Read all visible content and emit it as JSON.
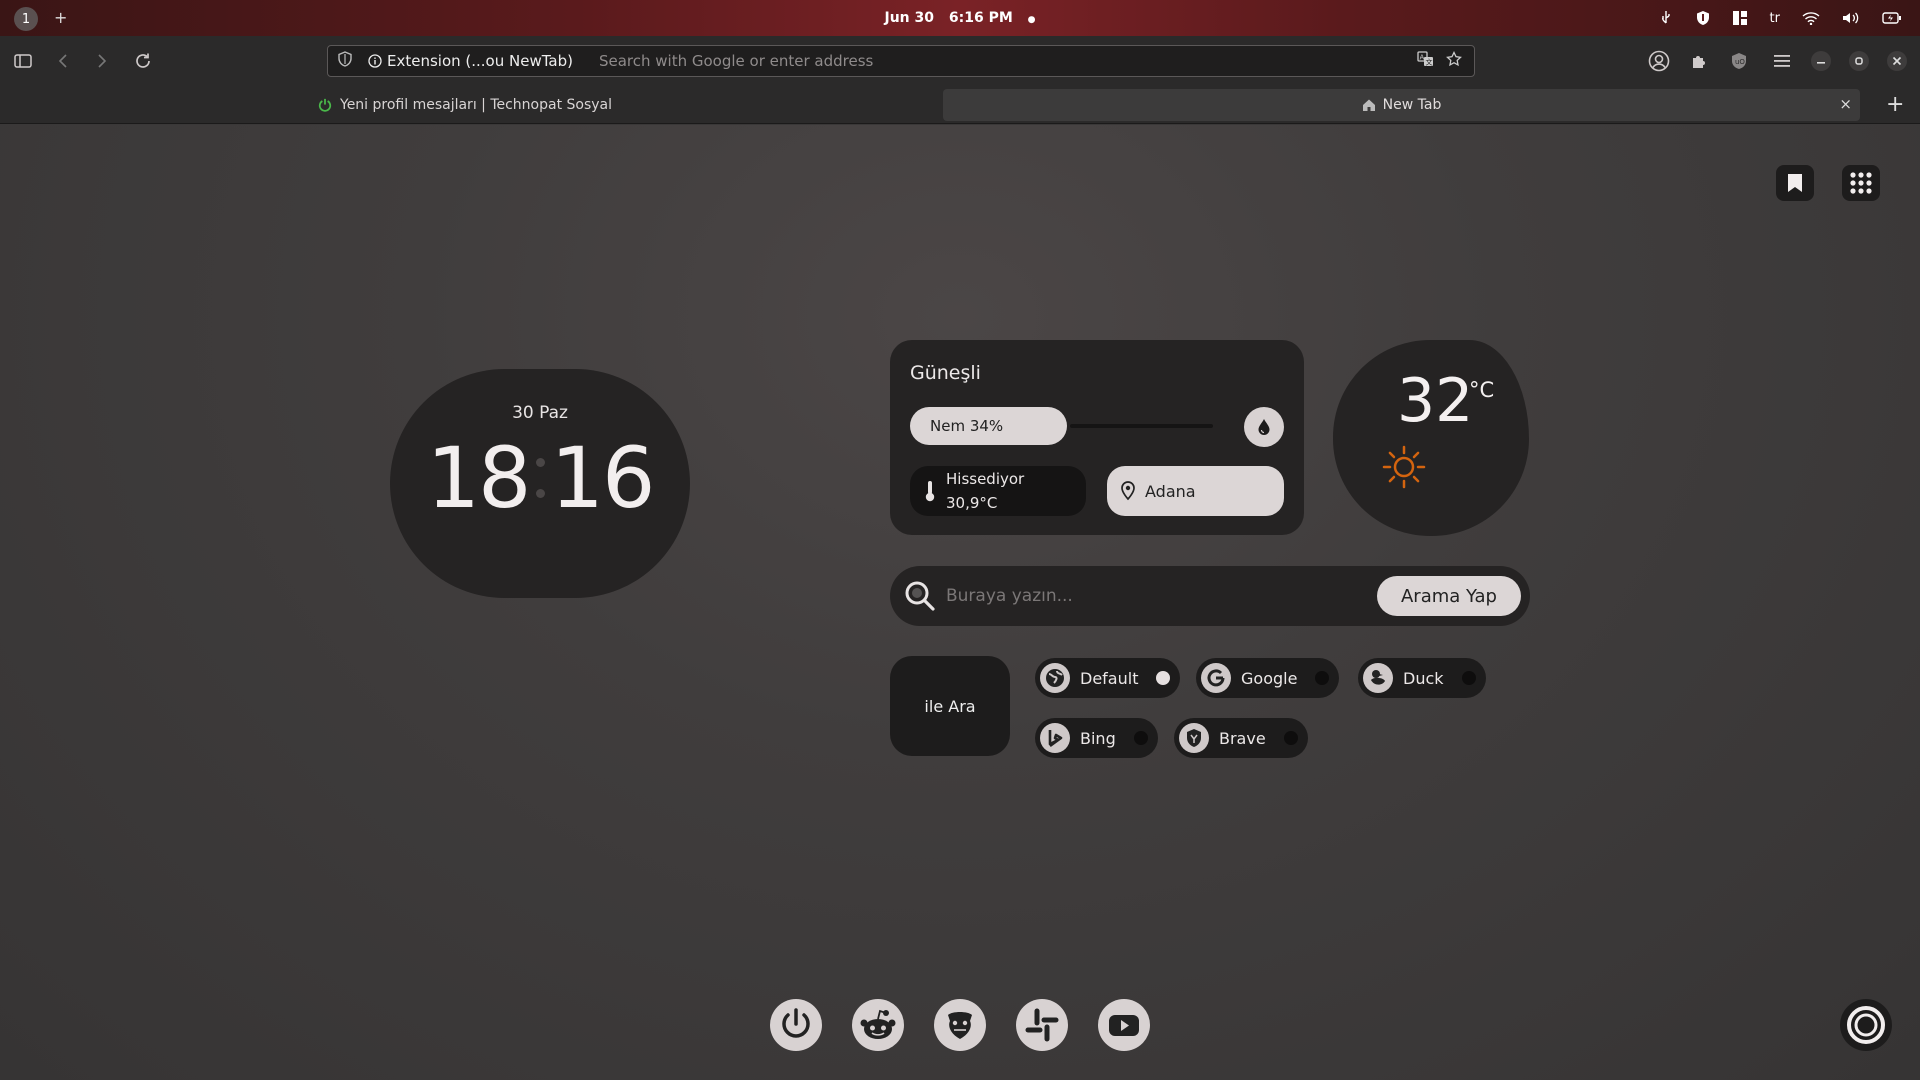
{
  "system_bar": {
    "workspace": "1",
    "add": "+",
    "date": "Jun 30",
    "time": "6:16 PM",
    "dot": "●",
    "keyboard_layout": "tr"
  },
  "browser": {
    "url_extension_label": "Extension (...ou NewTab)",
    "url_placeholder": "Search with Google or enter address",
    "tabs": [
      {
        "label": "Yeni profil mesajları | Technopat Sosyal",
        "active": false
      },
      {
        "label": "New Tab",
        "active": true
      }
    ],
    "close_tab": "×",
    "new_tab": "+"
  },
  "clock": {
    "date": "30 Paz",
    "hours": "18",
    "minutes": "16"
  },
  "weather": {
    "condition": "Güneşli",
    "humidity_label": "Nem 34%",
    "humidity_percent": 34,
    "feels_label": "Hissediyor",
    "feels_value": "30,9°C",
    "location": "Adana",
    "temperature": "32",
    "unit": "°C",
    "icon": "sun-icon",
    "sun_color": "#d4640f"
  },
  "search": {
    "placeholder": "Buraya yazın...",
    "button_label": "Arama Yap",
    "with_label": "ile Ara",
    "engines": [
      {
        "name": "Default",
        "selected": true
      },
      {
        "name": "Google",
        "selected": false
      },
      {
        "name": "Duck",
        "selected": false
      },
      {
        "name": "Bing",
        "selected": false
      },
      {
        "name": "Brave",
        "selected": false
      }
    ]
  },
  "dock": {
    "items": [
      "power-icon",
      "reddit-icon",
      "technopat-icon",
      "slack-icon",
      "youtube-icon"
    ]
  },
  "colors": {
    "card": "#252323",
    "pill_light": "#dcd6d6",
    "tab_indicator": "#4ab84a"
  }
}
